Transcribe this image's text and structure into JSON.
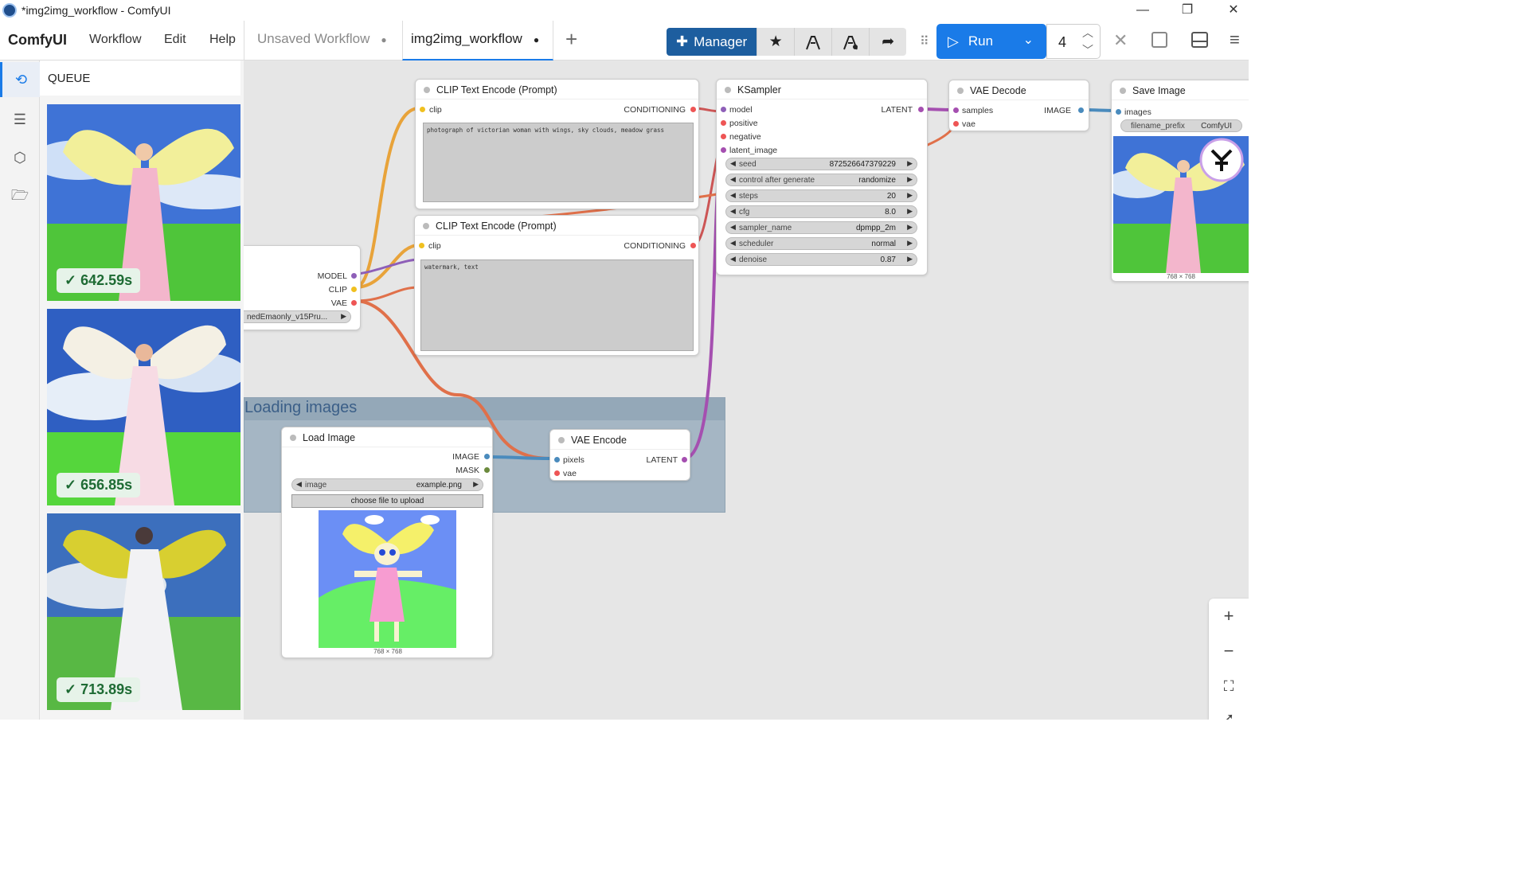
{
  "window": {
    "title": "*img2img_workflow - ComfyUI",
    "minimize": "—",
    "restore": "❐",
    "close": "✕"
  },
  "menubar": {
    "brand": "ComfyUI",
    "menus": [
      "Workflow",
      "Edit",
      "Help"
    ],
    "tabs": [
      {
        "label": "Unsaved Workflow",
        "dot": "●"
      },
      {
        "label": "img2img_workflow",
        "dot": "●"
      }
    ],
    "add_tab": "+",
    "manager_label": "Manager",
    "run_label": "Run",
    "queue_count": "4"
  },
  "queue": {
    "header": "QUEUE",
    "items": [
      {
        "time": "642.59s"
      },
      {
        "time": "656.85s"
      },
      {
        "time": "713.89s"
      }
    ]
  },
  "nodes": {
    "clip_pos": {
      "title": "CLIP Text Encode (Prompt)",
      "input": "clip",
      "output": "CONDITIONING",
      "text": "photograph of victorian woman with wings, sky clouds, meadow grass"
    },
    "clip_neg": {
      "title": "CLIP Text Encode (Prompt)",
      "input": "clip",
      "output": "CONDITIONING",
      "text": "watermark, text"
    },
    "checkpoint": {
      "outputs": [
        "MODEL",
        "CLIP",
        "VAE"
      ],
      "ckpt_value": "nedEmaonly_v15Pru..."
    },
    "ksampler": {
      "title": "KSampler",
      "inputs": [
        "model",
        "positive",
        "negative",
        "latent_image"
      ],
      "output": "LATENT",
      "widgets": [
        {
          "label": "seed",
          "value": "872526647379229"
        },
        {
          "label": "control after generate",
          "value": "randomize"
        },
        {
          "label": "steps",
          "value": "20"
        },
        {
          "label": "cfg",
          "value": "8.0"
        },
        {
          "label": "sampler_name",
          "value": "dpmpp_2m"
        },
        {
          "label": "scheduler",
          "value": "normal"
        },
        {
          "label": "denoise",
          "value": "0.87"
        }
      ]
    },
    "vae_decode": {
      "title": "VAE Decode",
      "inputs": [
        "samples",
        "vae"
      ],
      "output": "IMAGE"
    },
    "save_image": {
      "title": "Save Image",
      "input": "images",
      "prefix_label": "filename_prefix",
      "prefix_value": "ComfyUI",
      "size": "768 × 768"
    },
    "load_image": {
      "title": "Load Image",
      "outputs": [
        "IMAGE",
        "MASK"
      ],
      "image_label": "image",
      "image_value": "example.png",
      "upload_label": "choose file to upload",
      "size": "768 × 768"
    },
    "vae_encode": {
      "title": "VAE Encode",
      "inputs": [
        "pixels",
        "vae"
      ],
      "output": "LATENT"
    }
  },
  "group": {
    "title": "Loading images"
  },
  "colors": {
    "accent": "#1a7be8",
    "manager": "#1d5e9f",
    "model": "#b39ddb",
    "clip": "#ffd500",
    "vae": "#ff6e6e",
    "conditioning": "#ffa931",
    "latent": "#ff9cf9",
    "image": "#64b5f6"
  }
}
